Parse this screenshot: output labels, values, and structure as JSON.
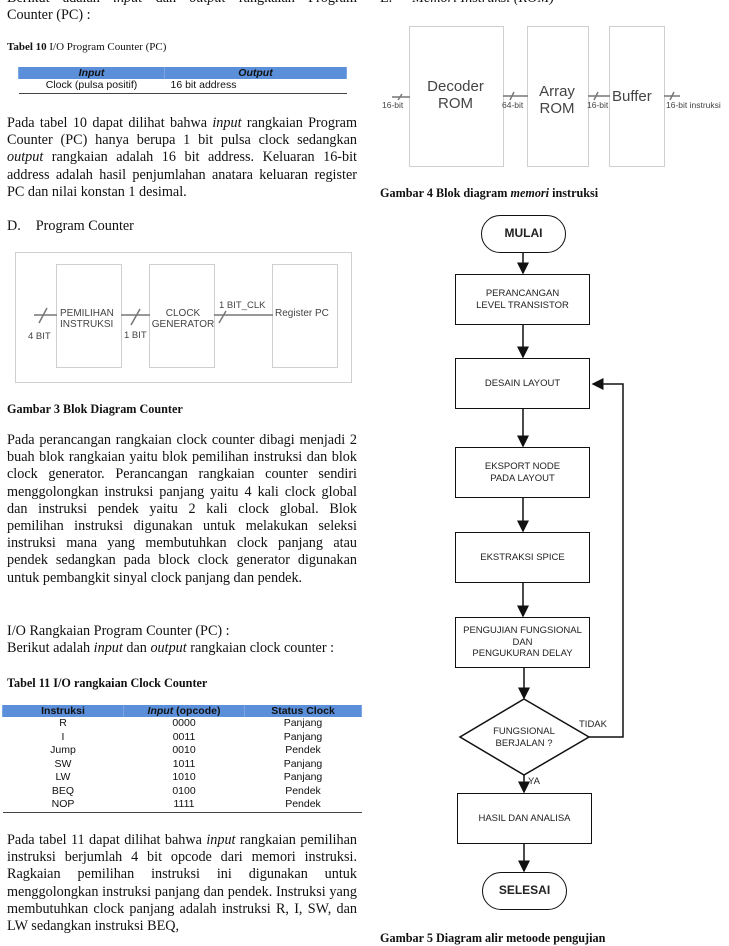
{
  "left": {
    "intro_line1": {
      "pre": "Berikut adalah ",
      "i1": "input",
      "mid": " dan ",
      "i2": "output",
      "post": " rangkaian Program"
    },
    "intro_line2": "Counter (PC) :",
    "table10": {
      "caption_bold": "Tabel 10",
      "caption_rest": " I/O Program Counter (PC)",
      "headers": [
        "Input",
        "Output"
      ],
      "rows": [
        [
          "Clock (pulsa positif)",
          "16 bit address"
        ]
      ],
      "header_color": "#5b8fd9"
    },
    "para1": {
      "t1": "Pada tabel 10 dapat dilihat bahwa ",
      "i1": "input",
      "t2": " rangkaian Program Counter (PC) hanya berupa 1 bit pulsa clock sedangkan ",
      "i2": "output",
      "t3": " rangkaian adalah 16 bit address. Keluaran 16-bit address adalah hasil penjumlahan anatara keluaran register PC  dan nilai konstan 1 desimal."
    },
    "section_d": {
      "num": "D.",
      "title": "Program Counter"
    },
    "fig3": {
      "blocks": [
        "PEMILIHAN\nINSTRUKSI",
        "CLOCK\nGENERATOR",
        "Register PC"
      ],
      "labels": {
        "in": "4 BIT",
        "mid": "1 BIT",
        "out": "1 BIT_CLK"
      },
      "caption": "Gambar 3 Blok Diagram Counter"
    },
    "para2": "Pada perancangan rangkaian clock counter dibagi menjadi 2 buah blok rangkaian yaitu blok pemilihan instruksi dan blok clock generator. Perancangan rangkaian counter sendiri menggolongkan instruksi panjang yaitu 4 kali clock global dan instruksi pendek yaitu 2 kali clock global. Blok pemilihan instruksi digunakan untuk melakukan seleksi instruksi mana yang membutuhkan clock panjang atau pendek sedangkan pada block clock generator digunakan untuk pembangkit sinyal clock panjang dan pendek.",
    "io_heading": "I/O Rangkaian Program Counter (PC) :",
    "io_line": {
      "pre": "Berikut adalah ",
      "i1": "input",
      "mid": " dan ",
      "i2": "output",
      "post": " rangkaian clock counter :"
    },
    "table11": {
      "caption": "Tabel 11 I/O rangkaian Clock Counter",
      "headers": {
        "c1": "Instruksi",
        "c2_italic": "Input",
        "c2_rest": " (opcode)",
        "c3": "Status Clock"
      },
      "rows": [
        [
          "R",
          "0000",
          "Panjang"
        ],
        [
          "I",
          "0011",
          "Panjang"
        ],
        [
          "Jump",
          "0010",
          "Pendek"
        ],
        [
          "SW",
          "1011",
          "Panjang"
        ],
        [
          "LW",
          "1010",
          "Panjang"
        ],
        [
          "BEQ",
          "0100",
          "Pendek"
        ],
        [
          "NOP",
          "1111",
          "Pendek"
        ]
      ]
    },
    "para3": {
      "t1": "Pada tabel 11 dapat dilihat bahwa ",
      "i1": "input",
      "t2": " rangkaian pemilihan instruksi berjumlah 4 bit opcode dari memori instruksi. Ragkaian pemilihan instruksi ini digunakan untuk menggolongkan instruksi panjang dan pendek. Instruksi yang membutuhkan clock panjang adalah instruksi R, I, SW, dan LW sedangkan instruksi BEQ,"
    }
  },
  "right": {
    "section_e": {
      "num": "E.",
      "title": "Memori Instruksi (ROM)"
    },
    "fig4": {
      "blocks": [
        "Decoder\nROM",
        "Array\nROM",
        "Buffer"
      ],
      "labels": {
        "in": "16-bit",
        "mid1": "64-bit",
        "mid2": "16-bit",
        "out": "16-bit instruksi"
      },
      "caption_pre": "Gambar 4 Blok diagram ",
      "caption_italic": "memori",
      "caption_post": " instruksi"
    },
    "flowchart": {
      "start": "MULAI",
      "steps": [
        "PERANCANGAN\nLEVEL TRANSISTOR",
        "DESAIN LAYOUT",
        "EKSPORT NODE\nPADA LAYOUT",
        "EKSTRAKSI SPICE",
        "PENGUJIAN FUNGSIONAL\nDAN\nPENGUKURAN DELAY"
      ],
      "decision": "FUNGSIONAL\nBERJALAN ?",
      "no_label": "TIDAK",
      "yes_label": "YA",
      "result": "HASIL DAN ANALISA",
      "end": "SELESAI"
    },
    "fig5_caption": "Gambar 5 Diagram alir metoode pengujian"
  }
}
